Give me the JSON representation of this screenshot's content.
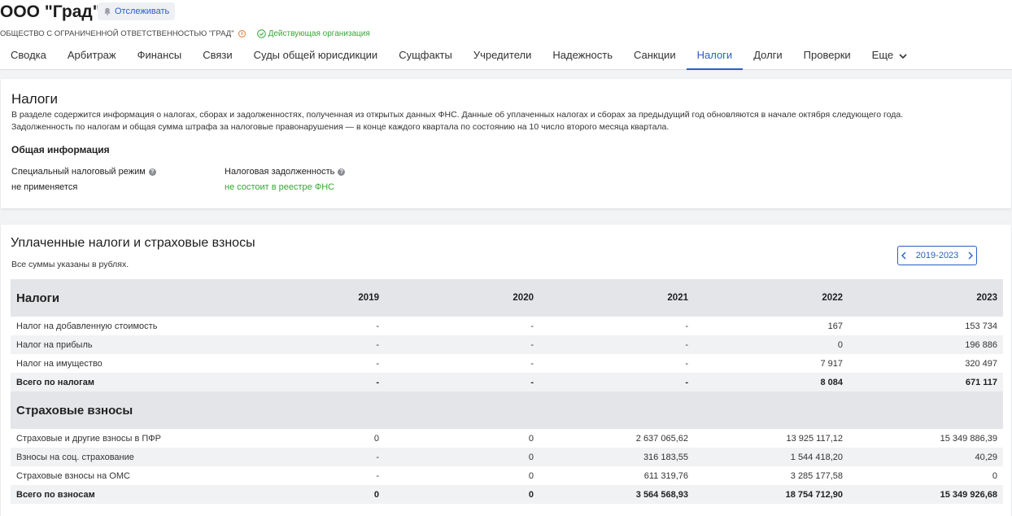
{
  "header": {
    "company_name": "ООО \"Град\"",
    "follow_label": "Отслеживать",
    "full_name": "ОБЩЕСТВО С ОГРАНИЧЕННОЙ ОТВЕТСТВЕННОСТЬЮ \"ГРАД\"",
    "status": "Действующая организация",
    "status_color": "#37a637"
  },
  "tabs": [
    {
      "label": "Сводка"
    },
    {
      "label": "Арбитраж"
    },
    {
      "label": "Финансы"
    },
    {
      "label": "Связи"
    },
    {
      "label": "Суды общей юрисдикции"
    },
    {
      "label": "Сущфакты"
    },
    {
      "label": "Учредители"
    },
    {
      "label": "Надежность"
    },
    {
      "label": "Санкции"
    },
    {
      "label": "Налоги",
      "active": true
    },
    {
      "label": "Долги"
    },
    {
      "label": "Проверки"
    },
    {
      "label": "Еще"
    }
  ],
  "taxes_section": {
    "title": "Налоги",
    "description_line1": "В разделе содержится информация о налогах, сборах и задолженностях, полученная из открытых данных ФНС. Данные об уплаченных налогах и сборах за предыдущий год обновляются в начале октября следующего года.",
    "description_line2": "Задолженность по налогам и общая сумма штрафа за налоговые правонарушения — в конце каждого квартала по состоянию на 10 число второго месяца квартала.",
    "general_title": "Общая информация",
    "special_regime_label": "Специальный налоговый режим",
    "special_regime_value": "не применяется",
    "tax_debt_label": "Налоговая задолженность",
    "tax_debt_value": "не состоит в реестре ФНС",
    "tax_debt_color": "#37a637"
  },
  "payments_section": {
    "title": "Уплаченные налоги и страховые взносы",
    "note": "Все суммы указаны в рублях.",
    "period": "2019-2023",
    "years": [
      "2019",
      "2020",
      "2021",
      "2022",
      "2023"
    ],
    "taxes_header": "Налоги",
    "tax_rows": [
      {
        "name": "Налог на добавленную стоимость",
        "values": [
          "-",
          "-",
          "-",
          "167",
          "153 734"
        ]
      },
      {
        "name": "Налог на прибыль",
        "values": [
          "-",
          "-",
          "-",
          "0",
          "196 886"
        ]
      },
      {
        "name": "Налог на имущество",
        "values": [
          "-",
          "-",
          "-",
          "7 917",
          "320 497"
        ]
      }
    ],
    "tax_total": {
      "name": "Всего по налогам",
      "values": [
        "-",
        "-",
        "-",
        "8 084",
        "671 117"
      ]
    },
    "insurance_header": "Страховые взносы",
    "insurance_rows": [
      {
        "name": "Страховые и другие взносы в ПФР",
        "values": [
          "0",
          "0",
          "2 637 065,62",
          "13 925 117,12",
          "15 349 886,39"
        ]
      },
      {
        "name": "Взносы на соц. страхование",
        "values": [
          "-",
          "0",
          "316 183,55",
          "1 544 418,20",
          "40,29"
        ]
      },
      {
        "name": "Страховые взносы на ОМС",
        "values": [
          "-",
          "0",
          "611 319,76",
          "3 285 177,58",
          "0"
        ]
      }
    ],
    "insurance_total": {
      "name": "Всего по взносам",
      "values": [
        "0",
        "0",
        "3 564 568,93",
        "18 754 712,90",
        "15 349 926,68"
      ]
    }
  },
  "colors": {
    "accent": "#2a5fc4",
    "table_header_bg": "#e3e5e8",
    "alt_row_bg": "#f1f2f4"
  }
}
